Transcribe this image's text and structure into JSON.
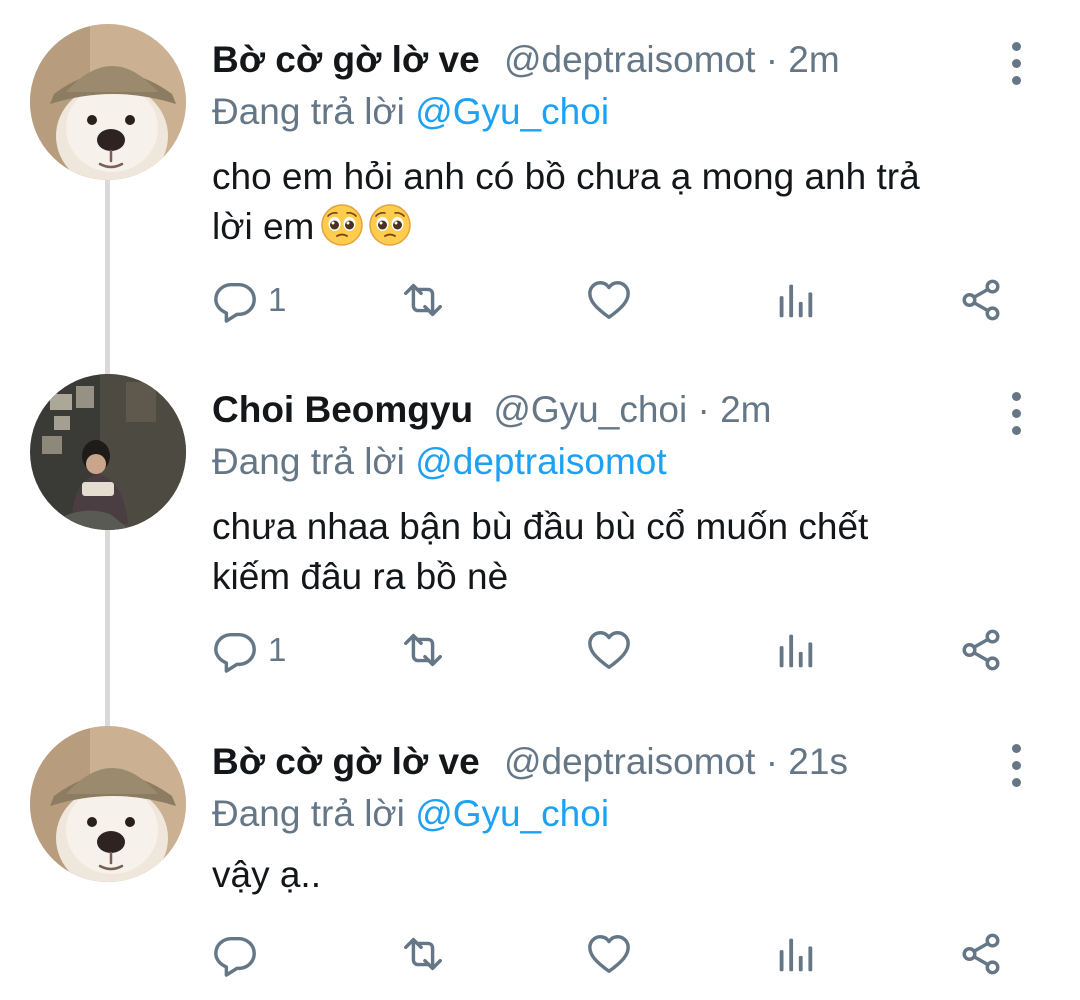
{
  "colors": {
    "accent": "#1da1f2",
    "muted": "#657786",
    "text": "#14171a",
    "thread_line": "#d9d9d9"
  },
  "tweets": [
    {
      "name": "Bờ cờ gờ lờ ve",
      "handle": "@deptraisomot",
      "separator": "·",
      "time": "2m",
      "reply_prefix": "Đang trả lời",
      "reply_to": "@Gyu_choi",
      "text_line1": "cho em hỏi anh có bồ chưa ạ mong anh trả",
      "text_line2": "lời em",
      "emoji": [
        "pleading-face",
        "pleading-face"
      ],
      "reply_count": "1",
      "avatar": "dog-with-bucket-hat"
    },
    {
      "name": "Choi Beomgyu",
      "handle": "@Gyu_choi",
      "separator": "·",
      "time": "2m",
      "reply_prefix": "Đang trả lời",
      "reply_to": "@deptraisomot",
      "text_line1": "chưa nhaa bận bù đầu bù cổ muốn chết",
      "text_line2": "kiếm đâu ra bồ nè",
      "reply_count": "1",
      "avatar": "person-sitting-with-camera"
    },
    {
      "name": "Bờ cờ gờ lờ ve",
      "handle": "@deptraisomot",
      "separator": "·",
      "time": "21s",
      "reply_prefix": "Đang trả lời",
      "reply_to": "@Gyu_choi",
      "text_line1": "vậy ạ..",
      "reply_count": "",
      "avatar": "dog-with-bucket-hat"
    }
  ],
  "icons": [
    "reply-icon",
    "retweet-icon",
    "like-icon",
    "analytics-icon",
    "share-icon",
    "more-icon"
  ]
}
